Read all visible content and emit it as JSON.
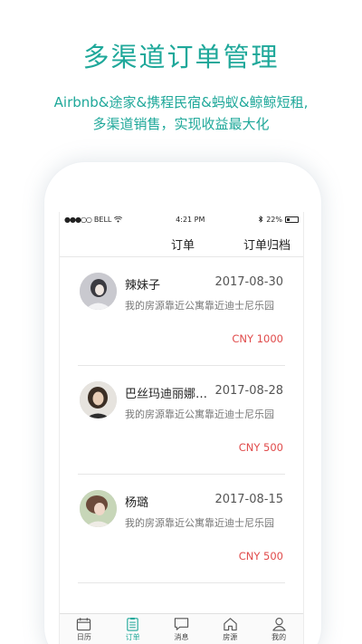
{
  "promo": {
    "headline": "多渠道订单管理",
    "subline_1": "Airbnb&途家&携程民宿&蚂蚁&鲸鲸短租,",
    "subline_2": "多渠道销售，实现收益最大化"
  },
  "status_bar": {
    "carrier": "BELL",
    "signal_dots": "●●●○○",
    "time": "4:21 PM",
    "battery": "22%"
  },
  "nav": {
    "title": "订单",
    "archive_label": "订单归档"
  },
  "orders": [
    {
      "name": "辣妹子",
      "date": "2017-08-30",
      "desc": "我的房源靠近公寓靠近迪士尼乐园",
      "price": "CNY 1000"
    },
    {
      "name": "巴丝玛迪丽娜热巴",
      "date": "2017-08-28",
      "desc": "我的房源靠近公寓靠近迪士尼乐园",
      "price": "CNY 500"
    },
    {
      "name": "杨璐",
      "date": "2017-08-15",
      "desc": "我的房源靠近公寓靠近迪士尼乐园",
      "price": "CNY 500"
    }
  ],
  "tabs": [
    {
      "label": "日历",
      "icon": "calendar-icon"
    },
    {
      "label": "订单",
      "icon": "orders-icon"
    },
    {
      "label": "消息",
      "icon": "message-icon"
    },
    {
      "label": "房源",
      "icon": "house-icon"
    },
    {
      "label": "我的",
      "icon": "profile-icon"
    }
  ],
  "colors": {
    "accent": "#1fa89a",
    "price": "#e04a4a"
  }
}
